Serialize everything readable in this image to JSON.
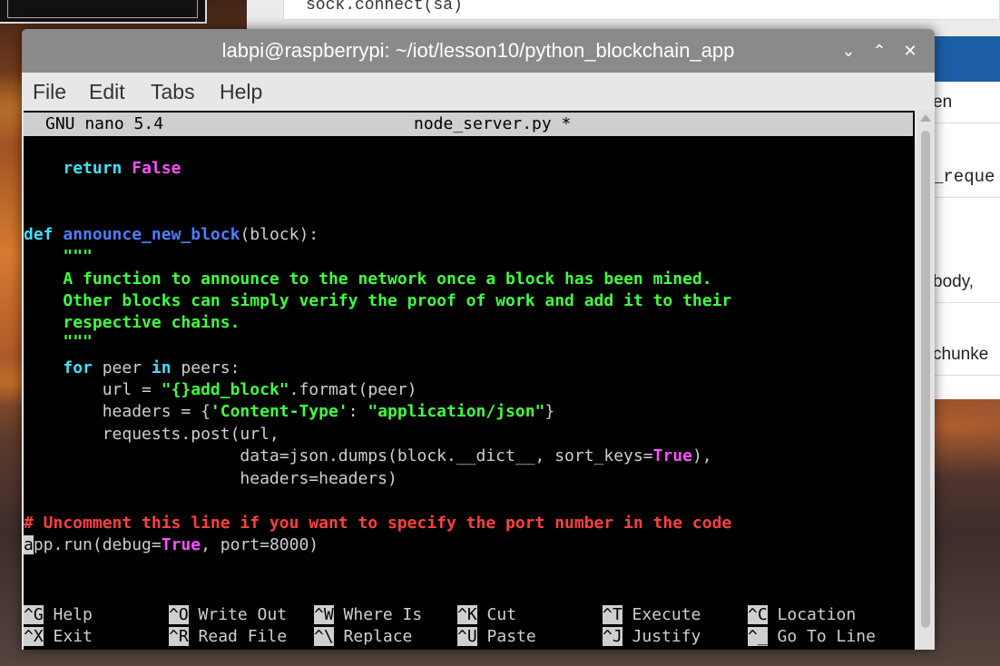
{
  "background_browser": {
    "code_snippet": "sock.connect(sa)",
    "list_items": [
      "en",
      "_reque",
      "body,",
      "chunke"
    ]
  },
  "window": {
    "title": "labpi@raspberrypi: ~/iot/lesson10/python_blockchain_app",
    "controls": {
      "minimize": "⌄",
      "maximize": "⌃",
      "close": "✕"
    }
  },
  "menu": [
    "File",
    "Edit",
    "Tabs",
    "Help"
  ],
  "nano": {
    "version": "GNU nano 5.4",
    "filename": "node_server.py *"
  },
  "code": {
    "l1_kw": "return",
    "l1_val": "False",
    "l2_def": "def",
    "l2_fn": "announce_new_block",
    "l2_rest": "(block):",
    "l3": "\"\"\"",
    "l4": "A function to announce to the network once a block has been mined.",
    "l5": "Other blocks can simply verify the proof of work and add it to their",
    "l6": "respective chains.",
    "l7": "\"\"\"",
    "l8_for": "for",
    "l8_a": " peer ",
    "l8_in": "in",
    "l8_b": " peers:",
    "l9_a": "url = ",
    "l9_str": "\"{}add_block\"",
    "l9_b": ".format(peer)",
    "l10_a": "headers = {",
    "l10_s1": "'Content-Type'",
    "l10_b": ": ",
    "l10_s2": "\"application/json\"",
    "l10_c": "}",
    "l11": "requests.post(url,",
    "l12_a": "data=json.dumps(block.__dict__, sort_keys=",
    "l12_true": "True",
    "l12_b": "),",
    "l13": "headers=headers)",
    "l14": "# Uncomment this line if you want to specify the port number in the code",
    "l15_cursor": "a",
    "l15_a": "pp.run(debug=",
    "l15_true": "True",
    "l15_b": ", port=8000)"
  },
  "shortcuts": [
    {
      "key": "^G",
      "label": "Help"
    },
    {
      "key": "^O",
      "label": "Write Out"
    },
    {
      "key": "^W",
      "label": "Where Is"
    },
    {
      "key": "^K",
      "label": "Cut"
    },
    {
      "key": "^T",
      "label": "Execute"
    },
    {
      "key": "^C",
      "label": "Location"
    },
    {
      "key": "^X",
      "label": "Exit"
    },
    {
      "key": "^R",
      "label": "Read File"
    },
    {
      "key": "^\\",
      "label": "Replace"
    },
    {
      "key": "^U",
      "label": "Paste"
    },
    {
      "key": "^J",
      "label": "Justify"
    },
    {
      "key": "^_",
      "label": "Go To Line"
    }
  ]
}
